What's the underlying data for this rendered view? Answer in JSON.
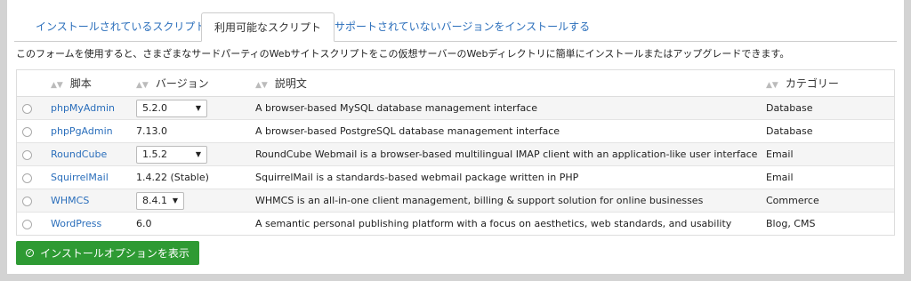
{
  "tabs": [
    {
      "label": "インストールされているスクリプト"
    },
    {
      "label": "利用可能なスクリプト"
    },
    {
      "label": "サポートされていないバージョンをインストールする"
    }
  ],
  "description": "このフォームを使用すると、さまざまなサードパーティのWebサイトスクリプトをこの仮想サーバーのWebディレクトリに簡単にインストールまたはアップグレードできます。",
  "table": {
    "headers": {
      "script": "脚本",
      "version": "バージョン",
      "description": "説明文",
      "category": "カテゴリー"
    },
    "rows": [
      {
        "name": "phpMyAdmin",
        "version": "5.2.0",
        "version_is_select": true,
        "description": "A browser-based MySQL database management interface",
        "category": "Database"
      },
      {
        "name": "phpPgAdmin",
        "version": "7.13.0",
        "version_is_select": false,
        "description": "A browser-based PostgreSQL database management interface",
        "category": "Database"
      },
      {
        "name": "RoundCube",
        "version": "1.5.2",
        "version_is_select": true,
        "description": "RoundCube Webmail is a browser-based multilingual IMAP client with an application-like user interface",
        "category": "Email"
      },
      {
        "name": "SquirrelMail",
        "version": "1.4.22 (Stable)",
        "version_is_select": false,
        "description": "SquirrelMail is a standards-based webmail package written in PHP",
        "category": "Email"
      },
      {
        "name": "WHMCS",
        "version": "8.4.1",
        "version_is_select": true,
        "description": "WHMCS is an all-in-one client management, billing & support solution for online businesses",
        "category": "Commerce"
      },
      {
        "name": "WordPress",
        "version": "6.0",
        "version_is_select": false,
        "description": "A semantic personal publishing platform with a focus on aesthetics, web standards, and usability",
        "category": "Blog, CMS"
      }
    ]
  },
  "install_button": {
    "label": "インストールオプションを表示",
    "icon": "check-circle-icon"
  },
  "colors": {
    "link": "#2a6ebb",
    "button": "#2e9a33",
    "stripe": "#f5f5f5"
  }
}
